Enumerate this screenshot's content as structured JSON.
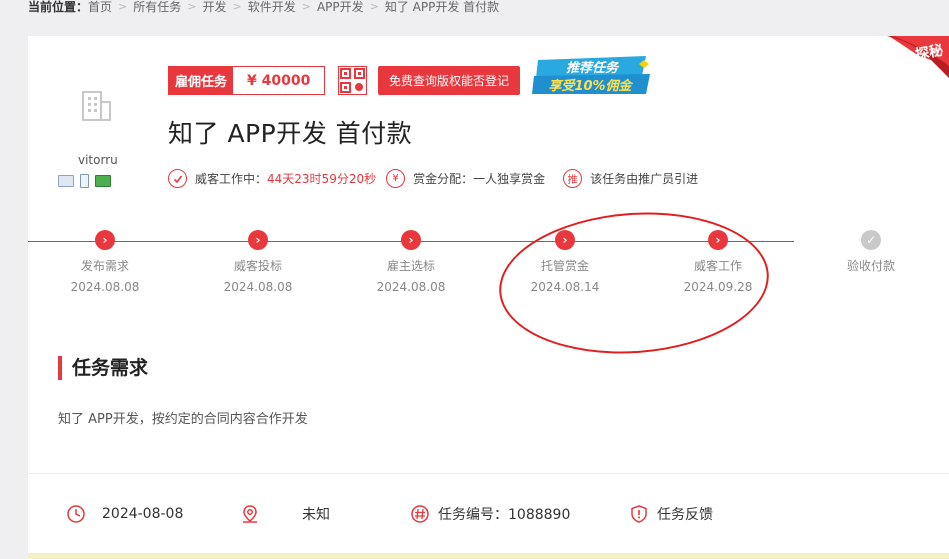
{
  "breadcrumb": {
    "label": "当前位置：",
    "items": [
      "首页",
      "所有任务",
      "开发",
      "软件开发",
      "APP开发",
      "知了 APP开发 首付款"
    ]
  },
  "ribbon": {
    "text": "探秘"
  },
  "employer": {
    "username": "vitorru"
  },
  "task": {
    "type_label": "雇佣任务",
    "price": "¥ 40000",
    "copyright_button": "免费查询版权能否登记",
    "promo_line1": "推荐任务",
    "promo_line2": "享受10%佣金",
    "title": "知了 APP开发 首付款"
  },
  "meta": {
    "working_label": "威客工作中：",
    "countdown": "44天23时59分20秒",
    "reward_label": "赏金分配：一人独享赏金",
    "referral_label": "该任务由推广员引进",
    "referral_icon_char": "推",
    "reward_icon_char": "¥"
  },
  "timeline": {
    "steps": [
      {
        "label": "发布需求",
        "date": "2024.08.08",
        "done": true
      },
      {
        "label": "威客投标",
        "date": "2024.08.08",
        "done": true
      },
      {
        "label": "雇主选标",
        "date": "2024.08.08",
        "done": true
      },
      {
        "label": "托管赏金",
        "date": "2024.08.14",
        "done": true
      },
      {
        "label": "威客工作",
        "date": "2024.09.28",
        "done": true
      },
      {
        "label": "验收付款",
        "date": "",
        "done": false
      }
    ]
  },
  "requirement": {
    "heading": "任务需求",
    "text": "知了 APP开发，按约定的合同内容合作开发"
  },
  "footer": {
    "date": "2024-08-08",
    "location": "未知",
    "task_no": "任务编号：1088890",
    "feedback": "任务反馈"
  },
  "colors": {
    "accent": "#e8383d",
    "muted": "#888888",
    "page_bg": "#efeff2"
  }
}
